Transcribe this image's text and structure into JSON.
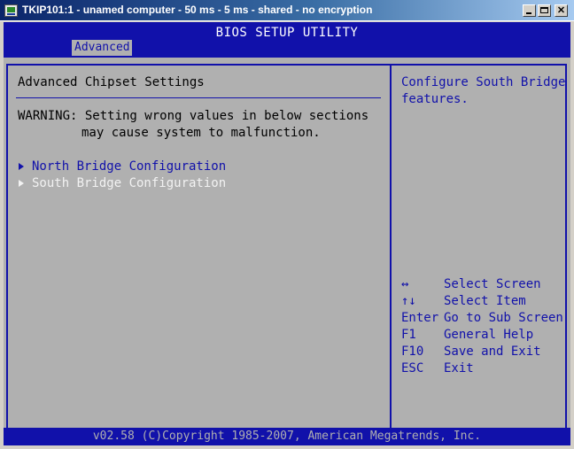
{
  "window": {
    "title": "TKIP101:1 - unamed computer - 50 ms - 5 ms - shared - no encryption",
    "close_glyph": "✕"
  },
  "bios": {
    "title": "BIOS SETUP UTILITY",
    "active_tab": "Advanced",
    "page_heading": "Advanced Chipset Settings",
    "warning_line1": "WARNING: Setting wrong values in below sections",
    "warning_line2": "may cause system to malfunction.",
    "menu_items": [
      {
        "label": "North Bridge Configuration"
      },
      {
        "label": "South Bridge Configuration",
        "selected": true
      }
    ],
    "help_line1": "Configure South Bridge",
    "help_line2": "features.",
    "keys": [
      {
        "key": "↔",
        "action": "Select Screen"
      },
      {
        "key": "↑↓",
        "action": "Select Item"
      },
      {
        "key": "Enter",
        "action": "Go to Sub Screen"
      },
      {
        "key": "F1",
        "action": "General Help"
      },
      {
        "key": "F10",
        "action": "Save and Exit"
      },
      {
        "key": "ESC",
        "action": "Exit"
      }
    ],
    "footer": "v02.58 (C)Copyright 1985-2007, American Megatrends, Inc."
  },
  "colors": {
    "bios_blue": "#1111aa",
    "bios_gray": "#b0b0b0",
    "highlight_white": "#f2f2f2"
  }
}
